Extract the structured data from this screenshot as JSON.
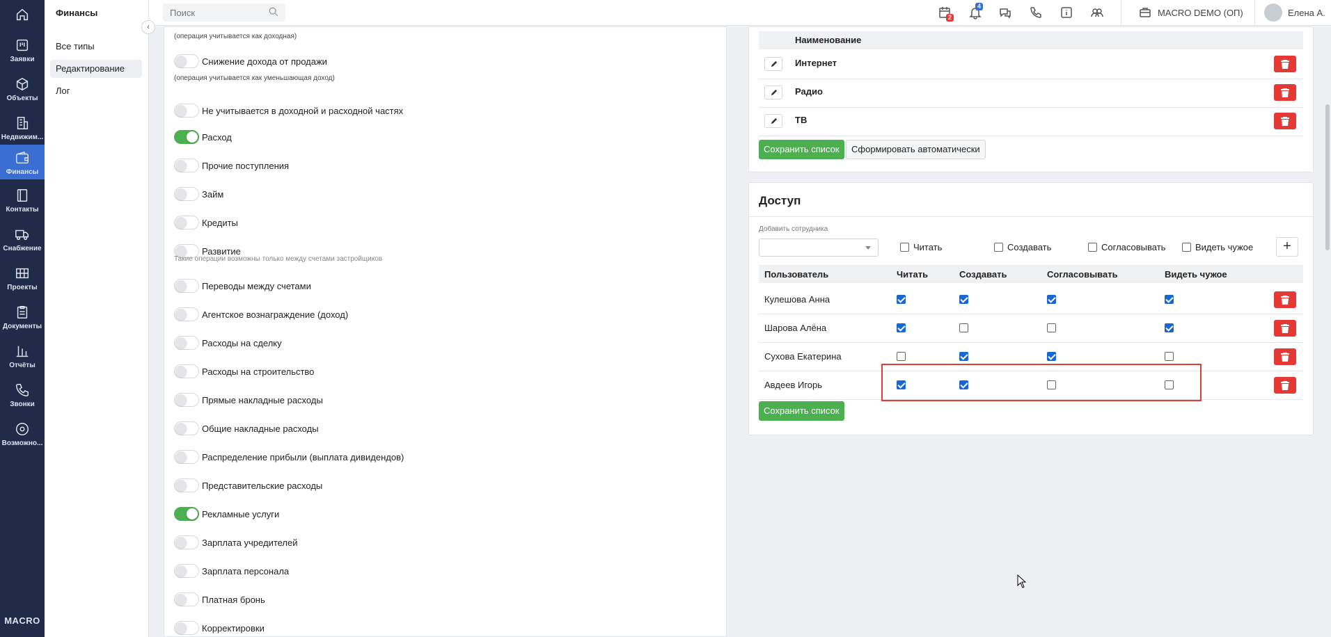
{
  "rail": {
    "items": [
      {
        "label": "",
        "icon": "home-icon"
      },
      {
        "label": "Заявки",
        "icon": "requests-icon"
      },
      {
        "label": "Объекты",
        "icon": "objects-icon"
      },
      {
        "label": "Недвижим...",
        "icon": "building-icon"
      },
      {
        "label": "Финансы",
        "icon": "wallet-icon"
      },
      {
        "label": "Контакты",
        "icon": "contacts-icon"
      },
      {
        "label": "Снабжение",
        "icon": "truck-icon"
      },
      {
        "label": "Проекты",
        "icon": "projects-icon"
      },
      {
        "label": "Документы",
        "icon": "documents-icon"
      },
      {
        "label": "Отчёты",
        "icon": "reports-icon"
      },
      {
        "label": "Звонки",
        "icon": "phone-icon"
      },
      {
        "label": "Возможно...",
        "icon": "settings-icon"
      }
    ],
    "logo": "MACRO"
  },
  "side": {
    "title": "Финансы",
    "items": [
      "Все типы",
      "Редактирование",
      "Лог"
    ]
  },
  "topbar": {
    "search_placeholder": "Поиск",
    "calendar_badge": "2",
    "bell_badge": "4",
    "company": "MACRO DEMO (ОП)",
    "user": "Елена А."
  },
  "types": {
    "hint_top": "(операция учитывается как доходная)",
    "rows": [
      {
        "label": "Снижение дохода от продажи",
        "on": false
      },
      {
        "label": "Не учитывается в доходной и расходной частях",
        "on": false
      },
      {
        "label": "Расход",
        "on": true
      },
      {
        "label": "Прочие поступления",
        "on": false
      },
      {
        "label": "Займ",
        "on": false
      },
      {
        "label": "Кредиты",
        "on": false
      },
      {
        "label": "Развитие",
        "on": false
      },
      {
        "label": "Переводы между счетами",
        "on": false
      },
      {
        "label": "Агентское вознаграждение (доход)",
        "on": false
      },
      {
        "label": "Расходы на сделку",
        "on": false
      },
      {
        "label": "Расходы на строительство",
        "on": false
      },
      {
        "label": "Прямые накладные расходы",
        "on": false
      },
      {
        "label": "Общие накладные расходы",
        "on": false
      },
      {
        "label": "Распределение прибыли (выплата дивидендов)",
        "on": false
      },
      {
        "label": "Представительские расходы",
        "on": false
      },
      {
        "label": "Рекламные услуги",
        "on": true
      },
      {
        "label": "Зарплата учредителей",
        "on": false
      },
      {
        "label": "Зарплата персонала",
        "on": false
      },
      {
        "label": "Платная бронь",
        "on": false
      },
      {
        "label": "Корректировки",
        "on": false
      }
    ],
    "hint_reduce": "(операция учитывается как уменьшающая доход)",
    "hint_dev": "Такие операции возможны только между счетами застройщиков"
  },
  "names": {
    "header": "Наименование",
    "items": [
      "Интернет",
      "Радио",
      "ТВ"
    ],
    "save": "Сохранить список",
    "auto": "Сформировать автоматически"
  },
  "access": {
    "title": "Доступ",
    "add_label": "Добавить сотрудника",
    "opt_read": "Читать",
    "opt_create": "Создавать",
    "opt_approve": "Согласовывать",
    "opt_see": "Видеть чужое",
    "columns": [
      "Пользователь",
      "Читать",
      "Создавать",
      "Согласовывать",
      "Видеть чужое"
    ],
    "users": [
      {
        "name": "Кулешова Анна",
        "read": true,
        "create": true,
        "approve": true,
        "see": true
      },
      {
        "name": "Шарова Алёна",
        "read": true,
        "create": false,
        "approve": false,
        "see": true
      },
      {
        "name": "Сухова Екатерина",
        "read": false,
        "create": true,
        "approve": true,
        "see": false
      },
      {
        "name": "Авдеев Игорь",
        "read": true,
        "create": true,
        "approve": false,
        "see": false
      }
    ],
    "save": "Сохранить список"
  }
}
